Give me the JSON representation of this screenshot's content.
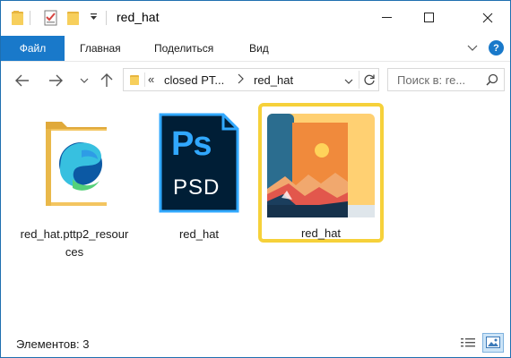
{
  "window": {
    "title": "red_hat",
    "controls": {
      "minimize": "minimize",
      "maximize": "maximize",
      "close": "close"
    }
  },
  "quick_access": {
    "icons": [
      "folder-icon",
      "properties-icon",
      "new-folder-icon",
      "customize-dropdown-icon"
    ]
  },
  "ribbon": {
    "tabs": [
      {
        "label": "Файл",
        "active": true
      },
      {
        "label": "Главная"
      },
      {
        "label": "Поделиться"
      },
      {
        "label": "Вид"
      }
    ],
    "help_label": "?"
  },
  "navigation": {
    "address": {
      "overflow": "«",
      "segments": [
        "closed PT...",
        "red_hat"
      ]
    },
    "search": {
      "placeholder": "Поиск в: re..."
    }
  },
  "files": [
    {
      "name": "red_hat.pttp2_resources",
      "type": "folder",
      "selected": false
    },
    {
      "name": "red_hat",
      "type": "psd",
      "icon_text": "Ps",
      "icon_sub": "PSD",
      "selected": false
    },
    {
      "name": "red_hat",
      "type": "image",
      "selected": true
    }
  ],
  "status": {
    "item_count": "Элементов: 3"
  },
  "colors": {
    "accent": "#1979ca",
    "selection_border": "#f6d13a",
    "folder": "#f3c560",
    "psd_bg": "#001e36",
    "psd_text": "#31a8ff"
  }
}
